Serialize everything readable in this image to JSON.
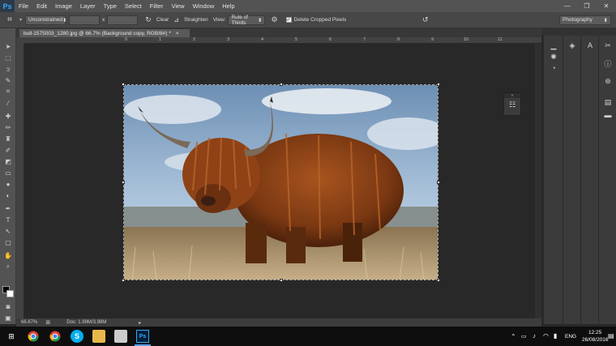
{
  "app": {
    "logo_text": "Ps",
    "menu": [
      "File",
      "Edit",
      "Image",
      "Layer",
      "Type",
      "Select",
      "Filter",
      "View",
      "Window",
      "Help"
    ],
    "window_controls": {
      "minimize": "—",
      "restore": "❐",
      "close": "✕"
    }
  },
  "options": {
    "ratio_select": "Unconstrained",
    "swap_symbol": "x",
    "clear_label": "Clear",
    "straighten_label": "Straighten",
    "view_label": "View:",
    "overlay_select": "Rule of Thirds",
    "delete_cropped_label": "Delete Cropped Pixels",
    "delete_cropped_checked": true,
    "workspace_select": "Photography"
  },
  "document": {
    "tab_title": "bull-1575003_1280.jpg @ 66.7% (Background copy, RGB/8#) *",
    "tab_close": "×",
    "ruler_labels": [
      "0",
      "1",
      "2",
      "3",
      "4",
      "5",
      "6",
      "7",
      "8",
      "9",
      "10",
      "11"
    ]
  },
  "status": {
    "zoom": "66.67%",
    "doc_size": "Doc: 1.99M/3.98M"
  },
  "taskbar": {
    "language": "ENG",
    "time": "12:25",
    "date": "26/08/2016"
  },
  "colors": {
    "accent": "#31a8ff",
    "menubar": "#535353",
    "canvas": "#282828"
  }
}
